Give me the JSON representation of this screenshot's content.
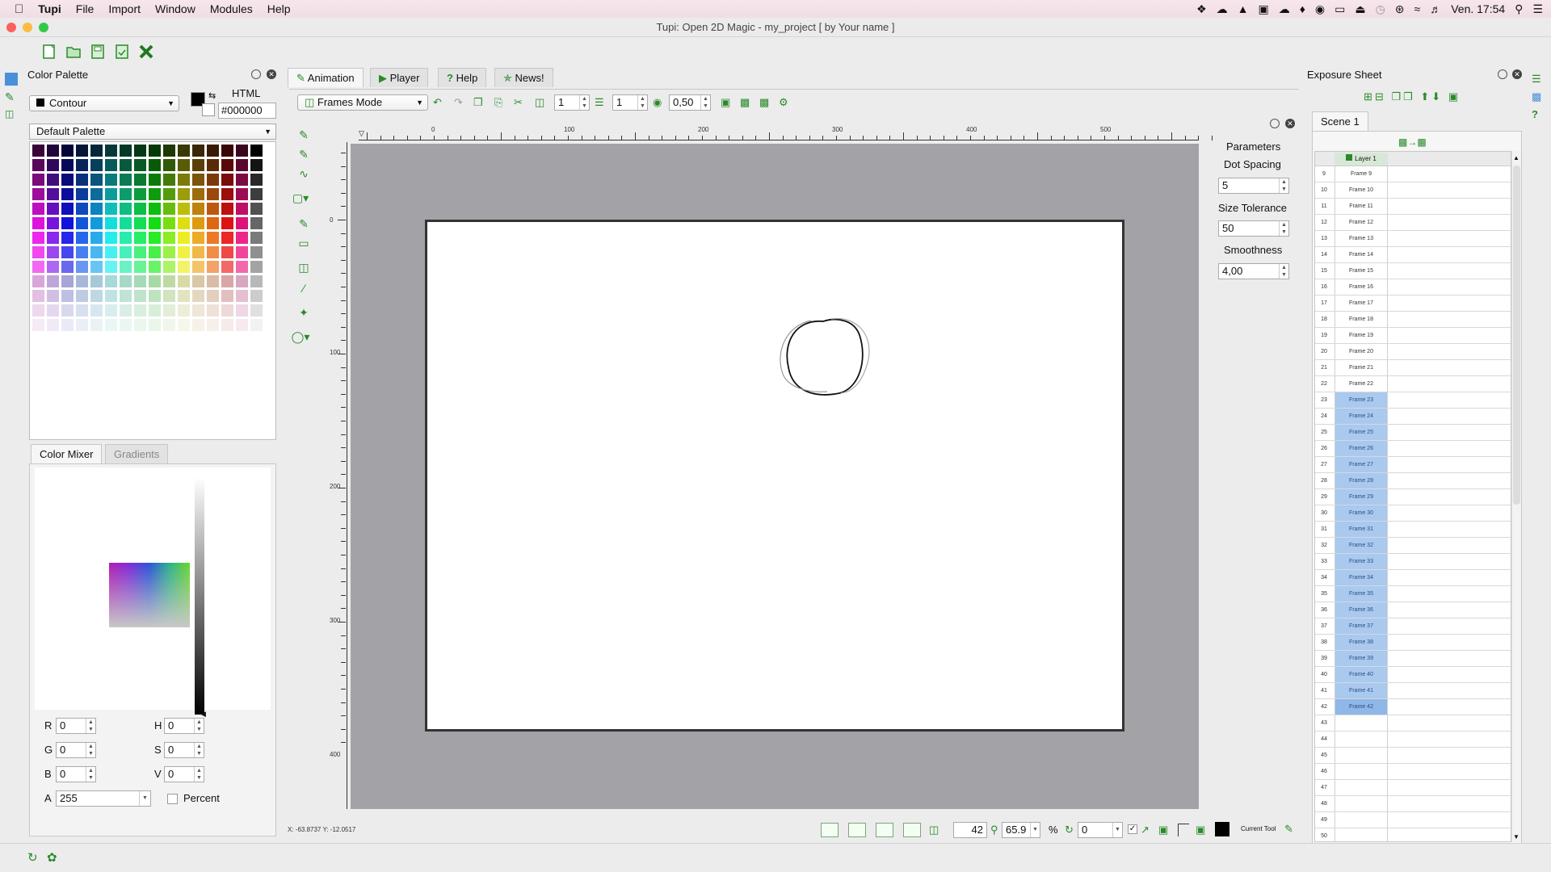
{
  "menubar": {
    "app": "Tupi",
    "items": [
      "File",
      "Import",
      "Window",
      "Modules",
      "Help"
    ],
    "clock": "Ven. 17:54"
  },
  "window": {
    "title": "Tupi: Open 2D Magic - my_project [ by Your name ]"
  },
  "color_palette": {
    "title": "Color Palette",
    "mode": "Contour",
    "html_label": "HTML",
    "html_value": "#000000",
    "palette_name": "Default Palette",
    "mixer_tabs": [
      "Color Mixer",
      "Gradients"
    ],
    "fields": {
      "r_label": "R",
      "r": "0",
      "g_label": "G",
      "g": "0",
      "b_label": "B",
      "b": "0",
      "h_label": "H",
      "h": "0",
      "s_label": "S",
      "s": "0",
      "v_label": "V",
      "v": "0",
      "a_label": "A",
      "a": "255",
      "percent_label": "Percent"
    }
  },
  "main_tabs": [
    "Animation",
    "Player",
    "Help",
    "News!"
  ],
  "anim_toolbar": {
    "mode": "Frames Mode",
    "spin1": "1",
    "spin2": "1",
    "opacity": "0,50"
  },
  "ruler": {
    "h_labels": [
      "0",
      "100",
      "200",
      "300",
      "400",
      "500"
    ],
    "v_labels": [
      "0",
      "100",
      "200",
      "300",
      "400"
    ]
  },
  "params": {
    "title": "Parameters",
    "dot_spacing_label": "Dot Spacing",
    "dot_spacing": "5",
    "size_tolerance_label": "Size Tolerance",
    "size_tolerance": "50",
    "smoothness_label": "Smoothness",
    "smoothness": "4,00"
  },
  "statusbar": {
    "coords": "X: -63.8737 Y: -12.0517",
    "frame": "42",
    "zoom": "65.9",
    "percent": "%",
    "rotation": "0",
    "current_tool_label": "Current Tool"
  },
  "exposure": {
    "title": "Exposure Sheet",
    "scene_tab": "Scene 1",
    "layer": "Layer 1",
    "rows": [
      {
        "n": "9",
        "f": "Frame 9",
        "sel": false
      },
      {
        "n": "10",
        "f": "Frame 10",
        "sel": false
      },
      {
        "n": "11",
        "f": "Frame 11",
        "sel": false
      },
      {
        "n": "12",
        "f": "Frame 12",
        "sel": false
      },
      {
        "n": "13",
        "f": "Frame 13",
        "sel": false
      },
      {
        "n": "14",
        "f": "Frame 14",
        "sel": false
      },
      {
        "n": "15",
        "f": "Frame 15",
        "sel": false
      },
      {
        "n": "16",
        "f": "Frame 16",
        "sel": false
      },
      {
        "n": "17",
        "f": "Frame 17",
        "sel": false
      },
      {
        "n": "18",
        "f": "Frame 18",
        "sel": false
      },
      {
        "n": "19",
        "f": "Frame 19",
        "sel": false
      },
      {
        "n": "20",
        "f": "Frame 20",
        "sel": false
      },
      {
        "n": "21",
        "f": "Frame 21",
        "sel": false
      },
      {
        "n": "22",
        "f": "Frame 22",
        "sel": false
      },
      {
        "n": "23",
        "f": "Frame 23",
        "sel": true
      },
      {
        "n": "24",
        "f": "Frame 24",
        "sel": true
      },
      {
        "n": "25",
        "f": "Frame 25",
        "sel": true
      },
      {
        "n": "26",
        "f": "Frame 26",
        "sel": true
      },
      {
        "n": "27",
        "f": "Frame 27",
        "sel": true
      },
      {
        "n": "28",
        "f": "Frame 28",
        "sel": true
      },
      {
        "n": "29",
        "f": "Frame 29",
        "sel": true
      },
      {
        "n": "30",
        "f": "Frame 30",
        "sel": true
      },
      {
        "n": "31",
        "f": "Frame 31",
        "sel": true
      },
      {
        "n": "32",
        "f": "Frame 32",
        "sel": true
      },
      {
        "n": "33",
        "f": "Frame 33",
        "sel": true
      },
      {
        "n": "34",
        "f": "Frame 34",
        "sel": true
      },
      {
        "n": "35",
        "f": "Frame 35",
        "sel": true
      },
      {
        "n": "36",
        "f": "Frame 36",
        "sel": true
      },
      {
        "n": "37",
        "f": "Frame 37",
        "sel": true
      },
      {
        "n": "38",
        "f": "Frame 38",
        "sel": true
      },
      {
        "n": "39",
        "f": "Frame 39",
        "sel": true
      },
      {
        "n": "40",
        "f": "Frame 40",
        "sel": true
      },
      {
        "n": "41",
        "f": "Frame 41",
        "sel": true
      },
      {
        "n": "42",
        "f": "Frame 42",
        "sel": true
      },
      {
        "n": "43",
        "f": "",
        "sel": false
      },
      {
        "n": "44",
        "f": "",
        "sel": false
      },
      {
        "n": "45",
        "f": "",
        "sel": false
      },
      {
        "n": "46",
        "f": "",
        "sel": false
      },
      {
        "n": "47",
        "f": "",
        "sel": false
      },
      {
        "n": "48",
        "f": "",
        "sel": false
      },
      {
        "n": "49",
        "f": "",
        "sel": false
      },
      {
        "n": "50",
        "f": "",
        "sel": false
      }
    ]
  },
  "colors": {
    "accent_green": "#2a8a2a",
    "canvas_bg": "#a2a2a7",
    "selected_frame": "#a9c9ef"
  }
}
